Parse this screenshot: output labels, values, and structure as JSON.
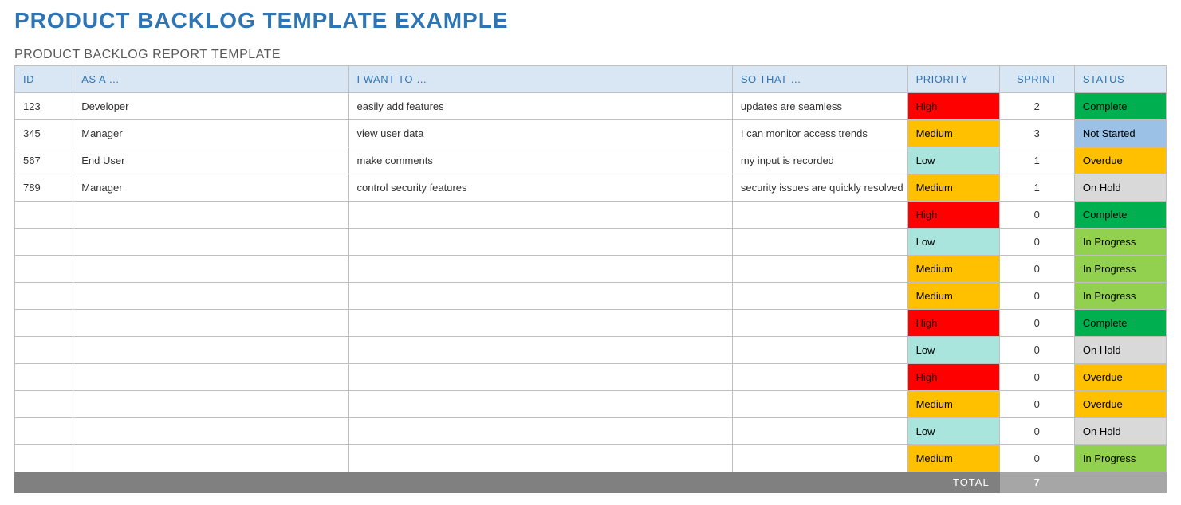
{
  "title": "PRODUCT BACKLOG TEMPLATE EXAMPLE",
  "subtitle": "PRODUCT BACKLOG REPORT TEMPLATE",
  "columns": {
    "id": "ID",
    "asa": "AS A …",
    "want": "I WANT TO …",
    "sothat": "SO THAT …",
    "priority": "PRIORITY",
    "sprint": "SPRINT",
    "status": "STATUS"
  },
  "rows": [
    {
      "id": "123",
      "asa": "Developer",
      "want": "easily add features",
      "sothat": "updates are seamless",
      "priority": "High",
      "sprint": "2",
      "status": "Complete"
    },
    {
      "id": "345",
      "asa": "Manager",
      "want": "view user data",
      "sothat": "I can monitor access trends",
      "priority": "Medium",
      "sprint": "3",
      "status": "Not Started"
    },
    {
      "id": "567",
      "asa": "End User",
      "want": "make comments",
      "sothat": "my input is recorded",
      "priority": "Low",
      "sprint": "1",
      "status": "Overdue"
    },
    {
      "id": "789",
      "asa": "Manager",
      "want": "control security features",
      "sothat": "security issues are quickly resolved",
      "priority": "Medium",
      "sprint": "1",
      "status": "On Hold"
    },
    {
      "id": "",
      "asa": "",
      "want": "",
      "sothat": "",
      "priority": "High",
      "sprint": "0",
      "status": "Complete"
    },
    {
      "id": "",
      "asa": "",
      "want": "",
      "sothat": "",
      "priority": "Low",
      "sprint": "0",
      "status": "In Progress"
    },
    {
      "id": "",
      "asa": "",
      "want": "",
      "sothat": "",
      "priority": "Medium",
      "sprint": "0",
      "status": "In Progress"
    },
    {
      "id": "",
      "asa": "",
      "want": "",
      "sothat": "",
      "priority": "Medium",
      "sprint": "0",
      "status": "In Progress"
    },
    {
      "id": "",
      "asa": "",
      "want": "",
      "sothat": "",
      "priority": "High",
      "sprint": "0",
      "status": "Complete"
    },
    {
      "id": "",
      "asa": "",
      "want": "",
      "sothat": "",
      "priority": "Low",
      "sprint": "0",
      "status": "On Hold"
    },
    {
      "id": "",
      "asa": "",
      "want": "",
      "sothat": "",
      "priority": "High",
      "sprint": "0",
      "status": "Overdue"
    },
    {
      "id": "",
      "asa": "",
      "want": "",
      "sothat": "",
      "priority": "Medium",
      "sprint": "0",
      "status": "Overdue"
    },
    {
      "id": "",
      "asa": "",
      "want": "",
      "sothat": "",
      "priority": "Low",
      "sprint": "0",
      "status": "On Hold"
    },
    {
      "id": "",
      "asa": "",
      "want": "",
      "sothat": "",
      "priority": "Medium",
      "sprint": "0",
      "status": "In Progress"
    }
  ],
  "footer": {
    "label": "TOTAL",
    "value": "7"
  }
}
